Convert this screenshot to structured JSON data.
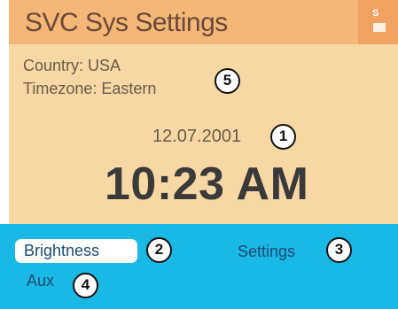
{
  "header": {
    "title": "SVC Sys Settings",
    "signal_indicator": "S",
    "signal_icon": "signal-strength-icon"
  },
  "info": {
    "country": "Country: USA",
    "timezone": "Timezone: Eastern"
  },
  "clock": {
    "date": "12.07.2001",
    "time": "10:23 AM"
  },
  "softkeys": {
    "brightness": "Brightness",
    "settings": "Settings",
    "aux": "Aux"
  },
  "callouts": [
    "1",
    "2",
    "3",
    "4",
    "5"
  ],
  "colors": {
    "top_panel": "#f7d8a4",
    "title_bar": "#f5b777",
    "bottom_panel": "#1ab8e4",
    "softkey_text": "#1d4a72"
  }
}
